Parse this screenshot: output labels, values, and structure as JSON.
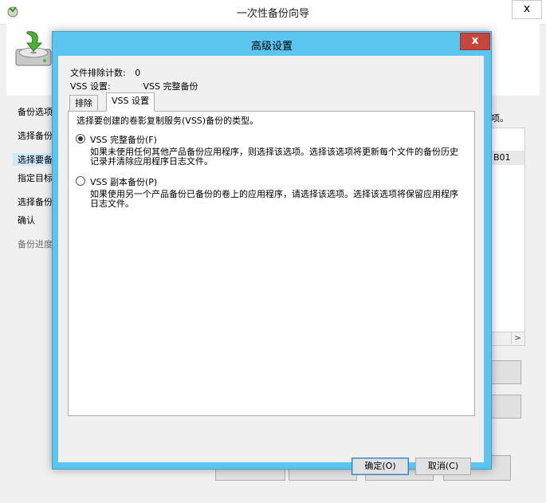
{
  "wizard": {
    "title": "一次性备份向导",
    "close_glyph": "x",
    "nav": [
      {
        "label": "备份选项",
        "state": "normal"
      },
      {
        "label": "选择备份",
        "state": "normal"
      },
      {
        "label": "选择要备",
        "state": "selected"
      },
      {
        "label": "指定目标",
        "state": "normal"
      },
      {
        "label": "选择备份",
        "state": "normal"
      },
      {
        "label": "确认",
        "state": "normal"
      },
      {
        "label": "备份进度",
        "state": "dim"
      }
    ],
    "right_text": "项。",
    "right_cell": "B01"
  },
  "dialog": {
    "title": "高级设置",
    "close_glyph": "x",
    "file_exclusion_label": "文件排除计数:",
    "file_exclusion_value": "0",
    "vss_setting_label": "VSS 设置:",
    "vss_setting_value": "VSS 完整备份",
    "tabs": [
      {
        "label": "排除",
        "active": false
      },
      {
        "label": "VSS 设置",
        "active": true
      }
    ],
    "panel": {
      "prompt": "选择要创建的卷影复制服务(VSS)备份的类型。",
      "options": [
        {
          "label": "VSS 完整备份(F)",
          "selected": true,
          "description": "如果未使用任何其他产品备份应用程序，则选择该选项。选择该选项将更新每个文件的备份历史记录并清除应用程序日志文件。"
        },
        {
          "label": "VSS 副本备份(P)",
          "selected": false,
          "description": "如果使用另一个产品备份已备份的卷上的应用程序，请选择该选项。选择该选项将保留应用程序日志文件。"
        }
      ]
    },
    "ok_label": "确定(O)",
    "cancel_label": "取消(C)"
  },
  "colors": {
    "dialog_frame": "#5ac6ef",
    "close_button": "#c7463b",
    "selected_nav": "#cde8ff"
  }
}
